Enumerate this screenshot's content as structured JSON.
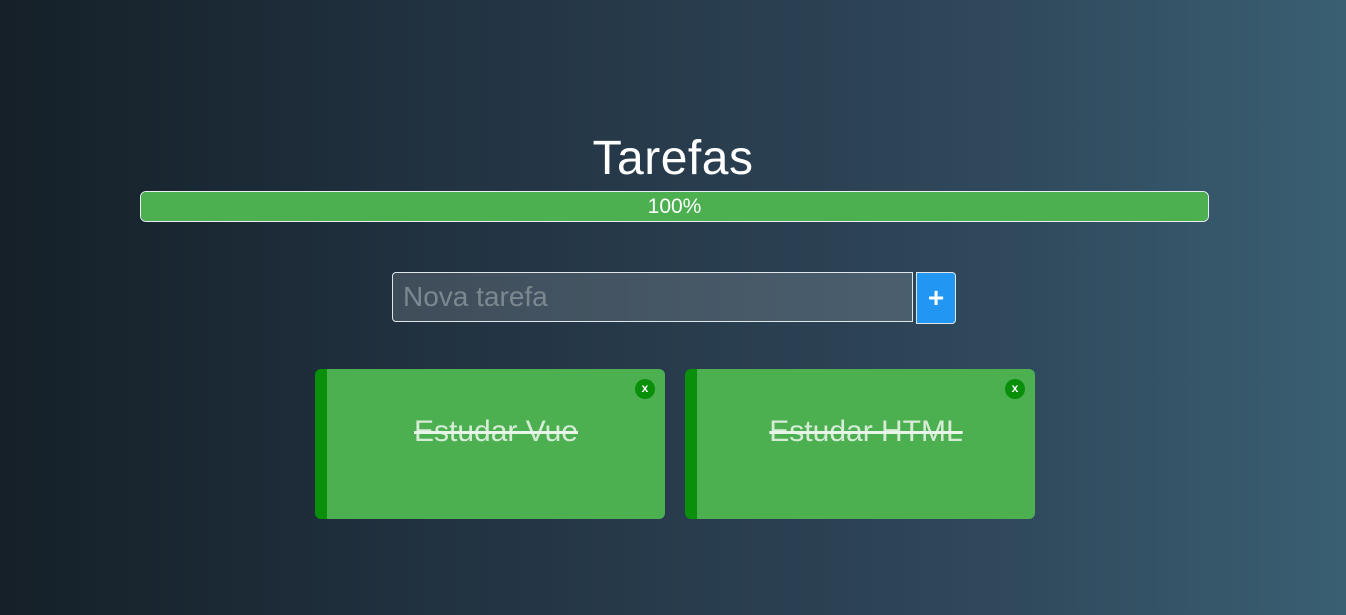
{
  "header": {
    "title": "Tarefas"
  },
  "progress": {
    "value": 100,
    "label": "100%"
  },
  "new_task": {
    "placeholder": "Nova tarefa",
    "value": "",
    "add_label": "+"
  },
  "tasks": [
    {
      "label": "Estudar Vue",
      "done": true,
      "close_label": "x"
    },
    {
      "label": "Estudar HTML",
      "done": true,
      "close_label": "x"
    }
  ],
  "colors": {
    "progress_fill": "#4caf50",
    "add_button": "#2196f3",
    "task_card": "#4caf50",
    "task_border": "#0a8f0a"
  }
}
